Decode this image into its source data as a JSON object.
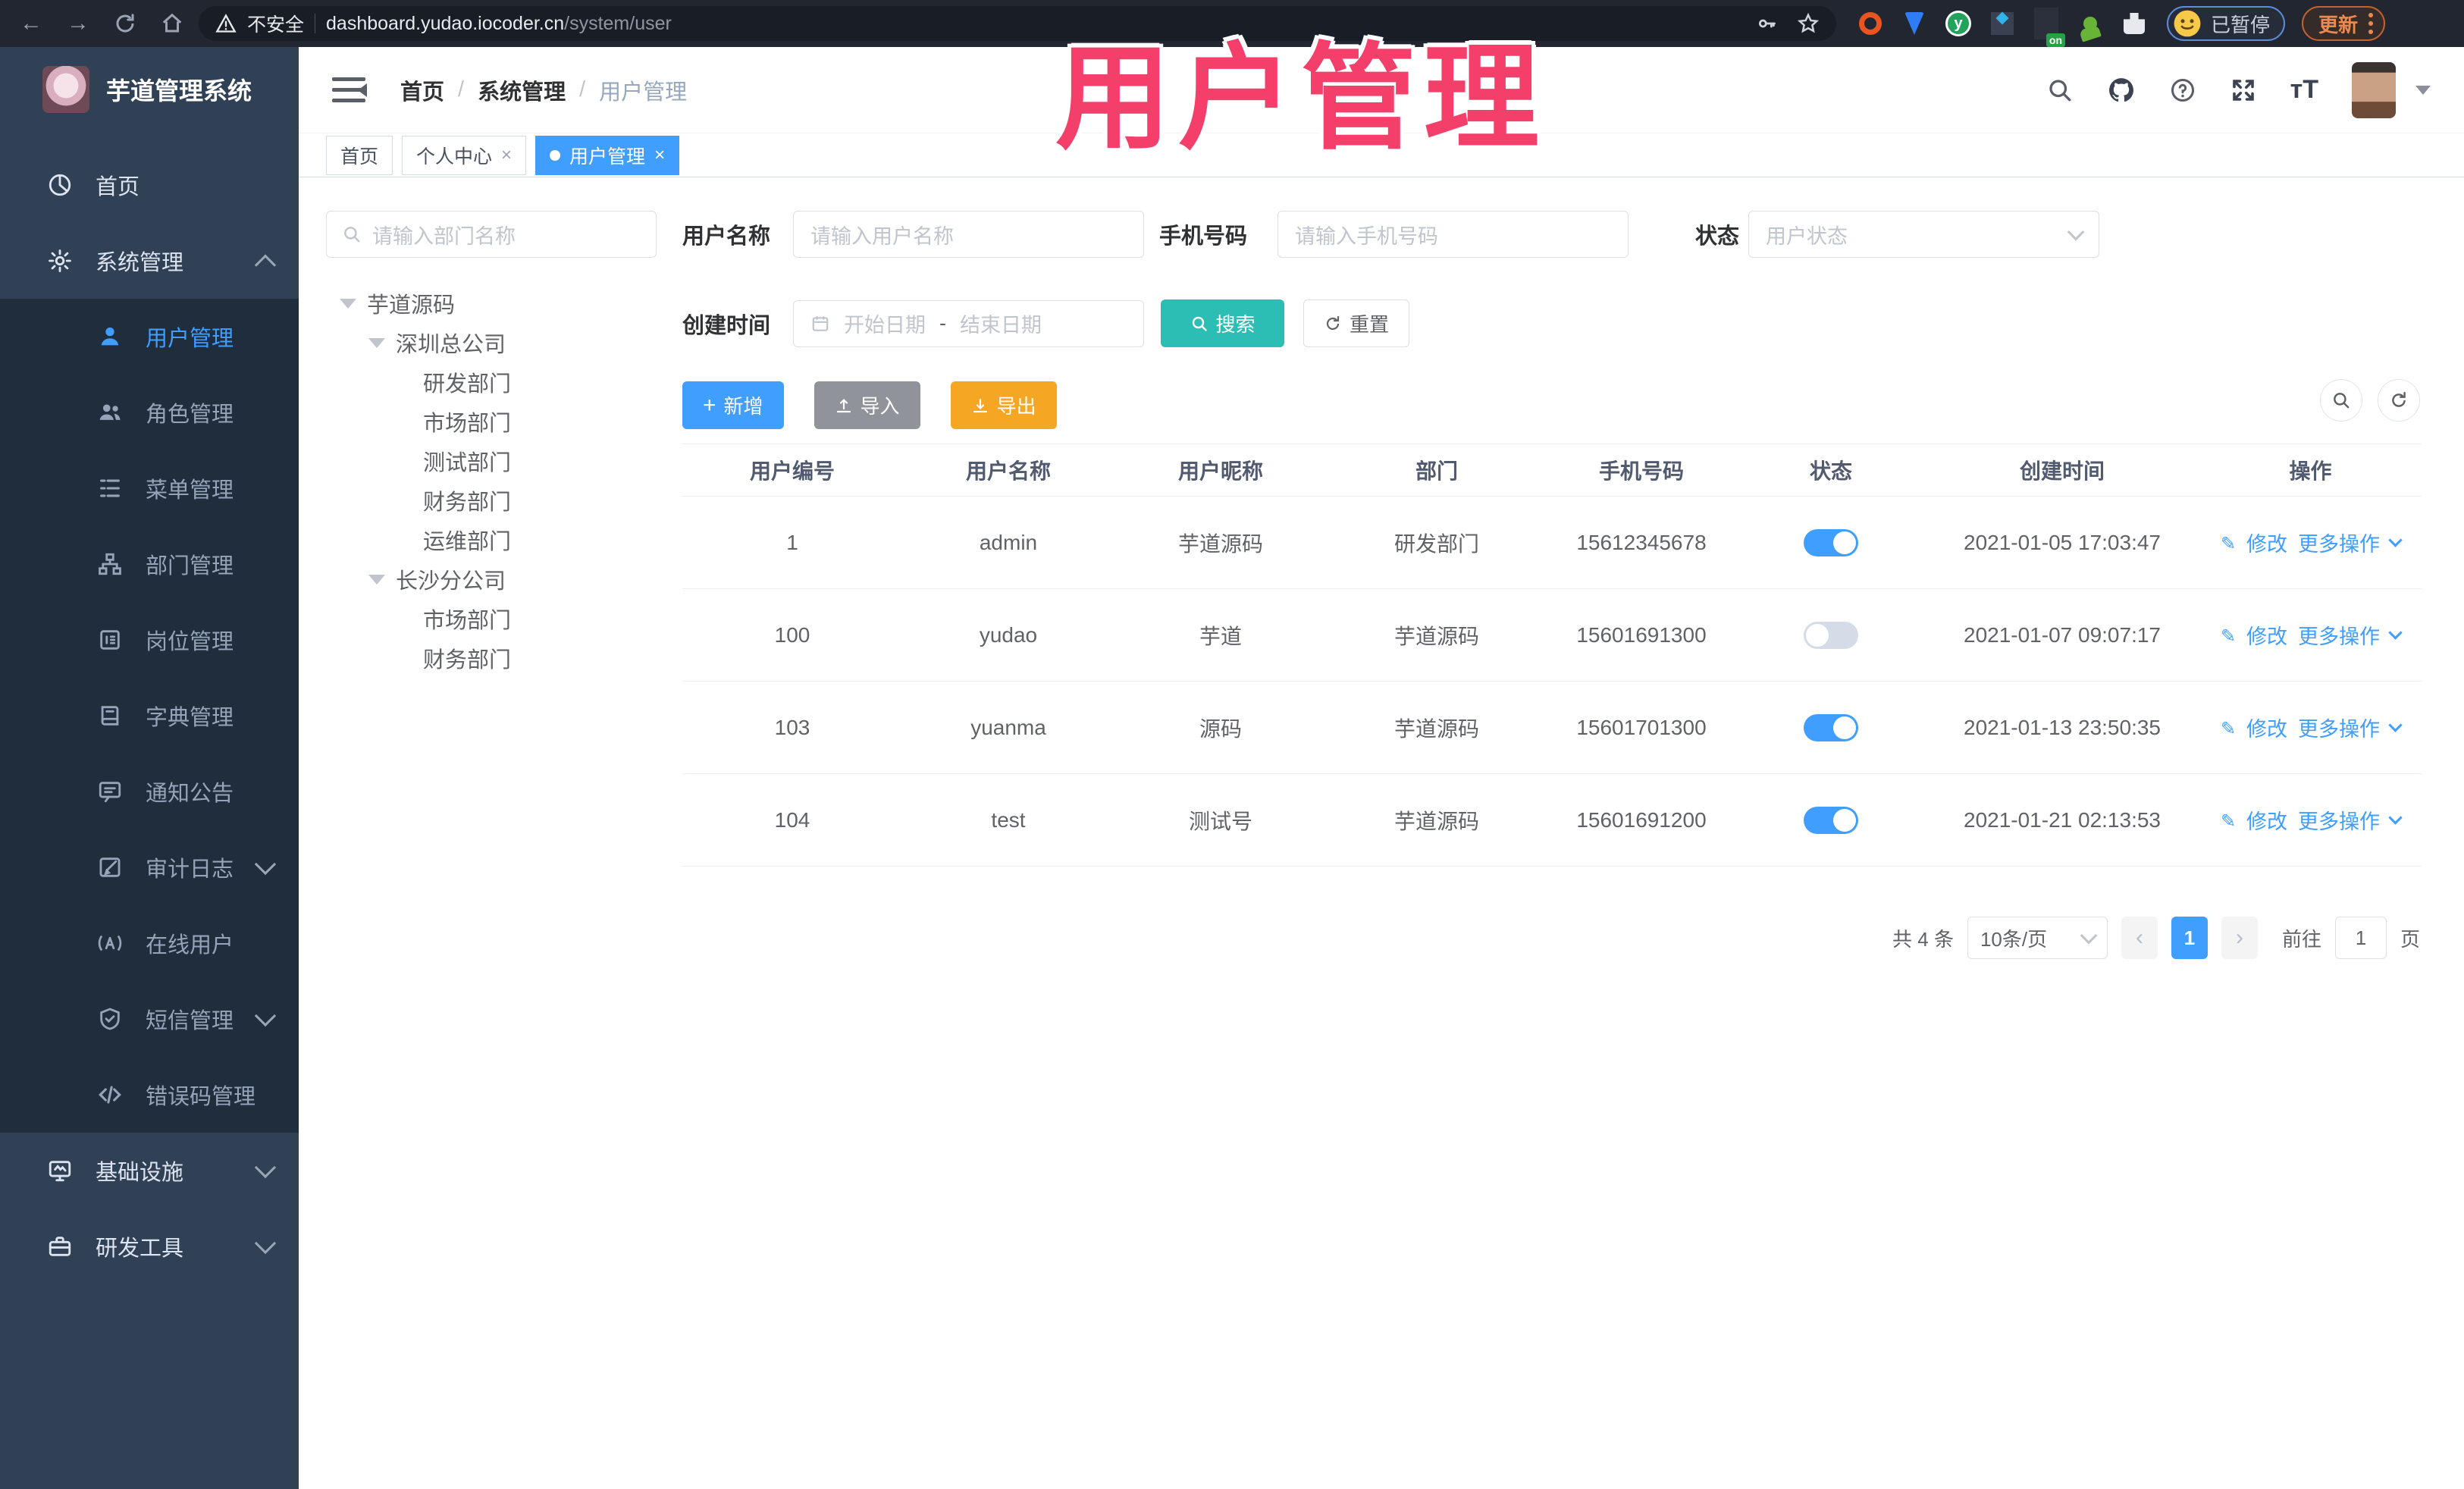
{
  "browser": {
    "security_label": "不安全",
    "url_host": "dashboard.yudao.iocoder.cn",
    "url_path": "/system/user",
    "profile_label": "已暂停",
    "update_label": "更新"
  },
  "overlay": {
    "text": "用户管理",
    "color": "#f43f6b"
  },
  "header": {
    "breadcrumb": [
      "首页",
      "系统管理",
      "用户管理"
    ]
  },
  "tabs": [
    {
      "label": "首页",
      "closable": false,
      "active": false
    },
    {
      "label": "个人中心",
      "closable": true,
      "active": false
    },
    {
      "label": "用户管理",
      "closable": true,
      "active": true
    }
  ],
  "sidebar": {
    "title": "芋道管理系统",
    "top": [
      {
        "label": "首页",
        "icon": "dashboard-icon"
      },
      {
        "label": "系统管理",
        "icon": "gear-icon",
        "expanded": true
      }
    ],
    "system_children": [
      {
        "label": "用户管理",
        "icon": "user-icon",
        "active": true
      },
      {
        "label": "角色管理",
        "icon": "users-icon"
      },
      {
        "label": "菜单管理",
        "icon": "menu-list-icon"
      },
      {
        "label": "部门管理",
        "icon": "tree-icon"
      },
      {
        "label": "岗位管理",
        "icon": "badge-icon"
      },
      {
        "label": "字典管理",
        "icon": "book-icon"
      },
      {
        "label": "通知公告",
        "icon": "message-icon"
      },
      {
        "label": "审计日志",
        "icon": "edit-log-icon",
        "collapsed": true
      },
      {
        "label": "在线用户",
        "icon": "online-icon"
      },
      {
        "label": "短信管理",
        "icon": "shield-icon",
        "collapsed": true
      },
      {
        "label": "错误码管理",
        "icon": "code-icon"
      }
    ],
    "bottom": [
      {
        "label": "基础设施",
        "icon": "monitor-icon",
        "collapsed": true
      },
      {
        "label": "研发工具",
        "icon": "toolbox-icon",
        "collapsed": true
      }
    ]
  },
  "dept": {
    "search_placeholder": "请输入部门名称",
    "tree": [
      {
        "label": "芋道源码",
        "level": 0,
        "expanded": true
      },
      {
        "label": "深圳总公司",
        "level": 1,
        "expanded": true
      },
      {
        "label": "研发部门",
        "level": 2
      },
      {
        "label": "市场部门",
        "level": 2
      },
      {
        "label": "测试部门",
        "level": 2
      },
      {
        "label": "财务部门",
        "level": 2
      },
      {
        "label": "运维部门",
        "level": 2
      },
      {
        "label": "长沙分公司",
        "level": 1,
        "expanded": true
      },
      {
        "label": "市场部门",
        "level": 2
      },
      {
        "label": "财务部门",
        "level": 2
      }
    ]
  },
  "filters": {
    "username_label": "用户名称",
    "username_placeholder": "请输入用户名称",
    "mobile_label": "手机号码",
    "mobile_placeholder": "请输入手机号码",
    "status_label": "状态",
    "status_placeholder": "用户状态",
    "created_label": "创建时间",
    "date_start_placeholder": "开始日期",
    "date_separator": "-",
    "date_end_placeholder": "结束日期",
    "search_label": "搜索",
    "reset_label": "重置"
  },
  "toolbar": {
    "add_label": "新增",
    "import_label": "导入",
    "export_label": "导出"
  },
  "table": {
    "headers": [
      "用户编号",
      "用户名称",
      "用户昵称",
      "部门",
      "手机号码",
      "状态",
      "创建时间",
      "操作"
    ],
    "action_edit": "修改",
    "action_more": "更多操作",
    "rows": [
      {
        "id": "1",
        "username": "admin",
        "nickname": "芋道源码",
        "dept": "研发部门",
        "mobile": "15612345678",
        "status": true,
        "created": "2021-01-05 17:03:47"
      },
      {
        "id": "100",
        "username": "yudao",
        "nickname": "芋道",
        "dept": "芋道源码",
        "mobile": "15601691300",
        "status": false,
        "created": "2021-01-07 09:07:17"
      },
      {
        "id": "103",
        "username": "yuanma",
        "nickname": "源码",
        "dept": "芋道源码",
        "mobile": "15601701300",
        "status": true,
        "created": "2021-01-13 23:50:35"
      },
      {
        "id": "104",
        "username": "test",
        "nickname": "测试号",
        "dept": "芋道源码",
        "mobile": "15601691200",
        "status": true,
        "created": "2021-01-21 02:13:53"
      }
    ]
  },
  "pagination": {
    "total": "共 4 条",
    "page_size": "10条/页",
    "current": "1",
    "goto_label": "前往",
    "goto_value": "1",
    "unit_label": "页"
  },
  "colors": {
    "primary": "#409eff",
    "search_teal": "#2cbdb4",
    "export_yellow": "#f5a623",
    "import_gray": "#909399",
    "sidebar_bg": "#304156",
    "submenu_bg": "#1f2d3d",
    "overlay_pink": "#f43f6b"
  }
}
